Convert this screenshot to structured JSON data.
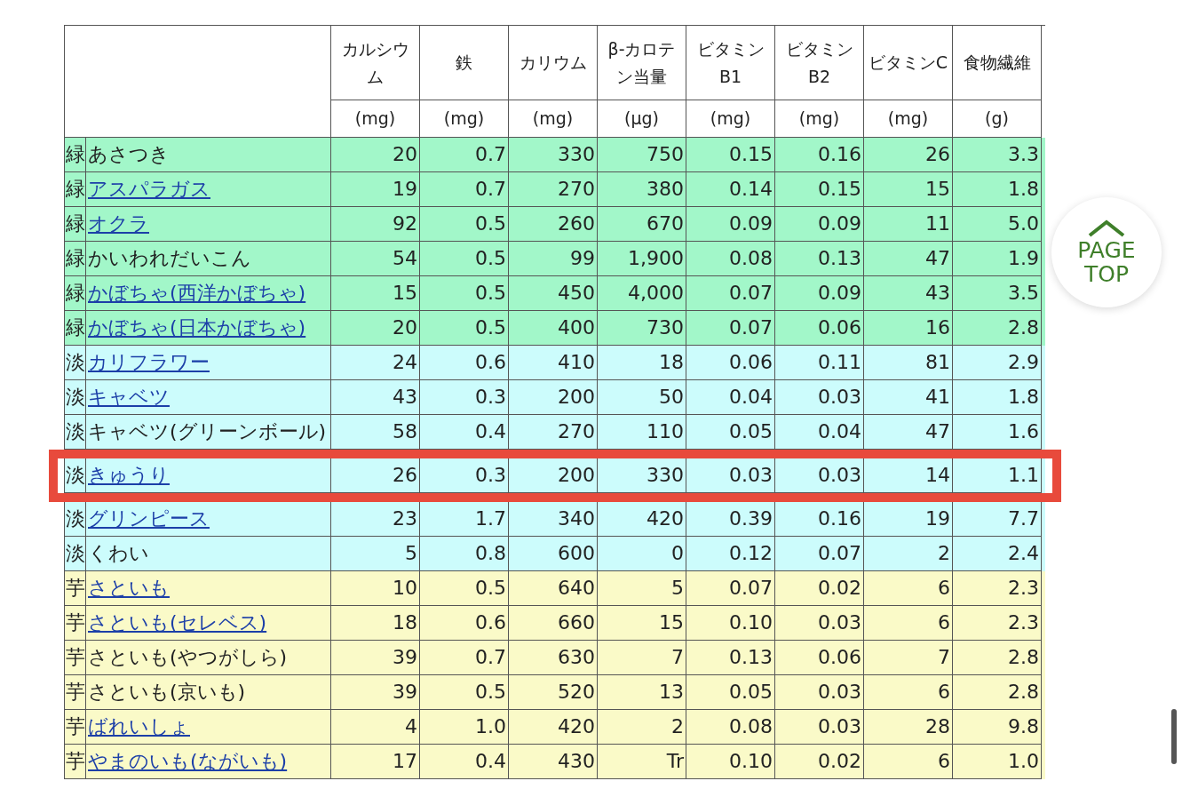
{
  "table": {
    "columns": [
      {
        "name": "カルシウム",
        "unit": "(mg)"
      },
      {
        "name": "鉄",
        "unit": "(mg)"
      },
      {
        "name": "カリウム",
        "unit": "(mg)"
      },
      {
        "name": "β-カロテン当量",
        "unit": "(μg)"
      },
      {
        "name": "ビタミンB1",
        "unit": "(mg)"
      },
      {
        "name": "ビタミンB2",
        "unit": "(mg)"
      },
      {
        "name": "ビタミンC",
        "unit": "(mg)"
      },
      {
        "name": "食物繊維",
        "unit": "(g)"
      }
    ],
    "rows": [
      {
        "category": "緑",
        "name": "あさつき",
        "link": false,
        "color": "#a2f7c9",
        "highlighted": false,
        "values": [
          "20",
          "0.7",
          "330",
          "750",
          "0.15",
          "0.16",
          "26",
          "3.3"
        ]
      },
      {
        "category": "緑",
        "name": "アスパラガス",
        "link": true,
        "color": "#a2f7c9",
        "highlighted": false,
        "values": [
          "19",
          "0.7",
          "270",
          "380",
          "0.14",
          "0.15",
          "15",
          "1.8"
        ]
      },
      {
        "category": "緑",
        "name": "オクラ",
        "link": true,
        "color": "#a2f7c9",
        "highlighted": false,
        "values": [
          "92",
          "0.5",
          "260",
          "670",
          "0.09",
          "0.09",
          "11",
          "5.0"
        ]
      },
      {
        "category": "緑",
        "name": "かいわれだいこん",
        "link": false,
        "color": "#a2f7c9",
        "highlighted": false,
        "values": [
          "54",
          "0.5",
          "99",
          "1,900",
          "0.08",
          "0.13",
          "47",
          "1.9"
        ]
      },
      {
        "category": "緑",
        "name": "かぼちゃ(西洋かぼちゃ)",
        "link": true,
        "color": "#a2f7c9",
        "highlighted": false,
        "values": [
          "15",
          "0.5",
          "450",
          "4,000",
          "0.07",
          "0.09",
          "43",
          "3.5"
        ]
      },
      {
        "category": "緑",
        "name": "かぼちゃ(日本かぼちゃ)",
        "link": true,
        "color": "#a2f7c9",
        "highlighted": false,
        "values": [
          "20",
          "0.5",
          "400",
          "730",
          "0.07",
          "0.06",
          "16",
          "2.8"
        ]
      },
      {
        "category": "淡",
        "name": "カリフラワー",
        "link": true,
        "color": "#ccfcfc",
        "highlighted": false,
        "values": [
          "24",
          "0.6",
          "410",
          "18",
          "0.06",
          "0.11",
          "81",
          "2.9"
        ]
      },
      {
        "category": "淡",
        "name": "キャベツ",
        "link": true,
        "color": "#ccfcfc",
        "highlighted": false,
        "values": [
          "43",
          "0.3",
          "200",
          "50",
          "0.04",
          "0.03",
          "41",
          "1.8"
        ]
      },
      {
        "category": "淡",
        "name": "キャベツ(グリーンボール)",
        "link": false,
        "color": "#ccfcfc",
        "highlighted": false,
        "values": [
          "58",
          "0.4",
          "270",
          "110",
          "0.05",
          "0.04",
          "47",
          "1.6"
        ]
      },
      {
        "category": "淡",
        "name": "きゅうり",
        "link": true,
        "color": "#ccfcfc",
        "highlighted": true,
        "values": [
          "26",
          "0.3",
          "200",
          "330",
          "0.03",
          "0.03",
          "14",
          "1.1"
        ]
      },
      {
        "category": "淡",
        "name": "グリンピース",
        "link": true,
        "color": "#ccfcfc",
        "highlighted": false,
        "values": [
          "23",
          "1.7",
          "340",
          "420",
          "0.39",
          "0.16",
          "19",
          "7.7"
        ]
      },
      {
        "category": "淡",
        "name": "くわい",
        "link": false,
        "color": "#ccfcfc",
        "highlighted": false,
        "values": [
          "5",
          "0.8",
          "600",
          "0",
          "0.12",
          "0.07",
          "2",
          "2.4"
        ]
      },
      {
        "category": "芋",
        "name": "さといも",
        "link": true,
        "color": "#fafac8",
        "highlighted": false,
        "values": [
          "10",
          "0.5",
          "640",
          "5",
          "0.07",
          "0.02",
          "6",
          "2.3"
        ]
      },
      {
        "category": "芋",
        "name": "さといも(セレベス)",
        "link": true,
        "color": "#fafac8",
        "highlighted": false,
        "values": [
          "18",
          "0.6",
          "660",
          "15",
          "0.10",
          "0.03",
          "6",
          "2.3"
        ]
      },
      {
        "category": "芋",
        "name": "さといも(やつがしら)",
        "link": false,
        "color": "#fafac8",
        "highlighted": false,
        "values": [
          "39",
          "0.7",
          "630",
          "7",
          "0.13",
          "0.06",
          "7",
          "2.8"
        ]
      },
      {
        "category": "芋",
        "name": "さといも(京いも)",
        "link": false,
        "color": "#fafac8",
        "highlighted": false,
        "values": [
          "39",
          "0.5",
          "520",
          "13",
          "0.05",
          "0.03",
          "6",
          "2.8"
        ]
      },
      {
        "category": "芋",
        "name": "ばれいしょ",
        "link": true,
        "color": "#fafac8",
        "highlighted": false,
        "values": [
          "4",
          "1.0",
          "420",
          "2",
          "0.08",
          "0.03",
          "28",
          "9.8"
        ]
      },
      {
        "category": "芋",
        "name": "やまのいも(ながいも)",
        "link": true,
        "color": "#fafac8",
        "highlighted": false,
        "values": [
          "17",
          "0.4",
          "430",
          "Tr",
          "0.10",
          "0.02",
          "6",
          "1.0"
        ]
      }
    ]
  },
  "page_top": {
    "label_1": "PAGE",
    "label_2": "TOP"
  }
}
